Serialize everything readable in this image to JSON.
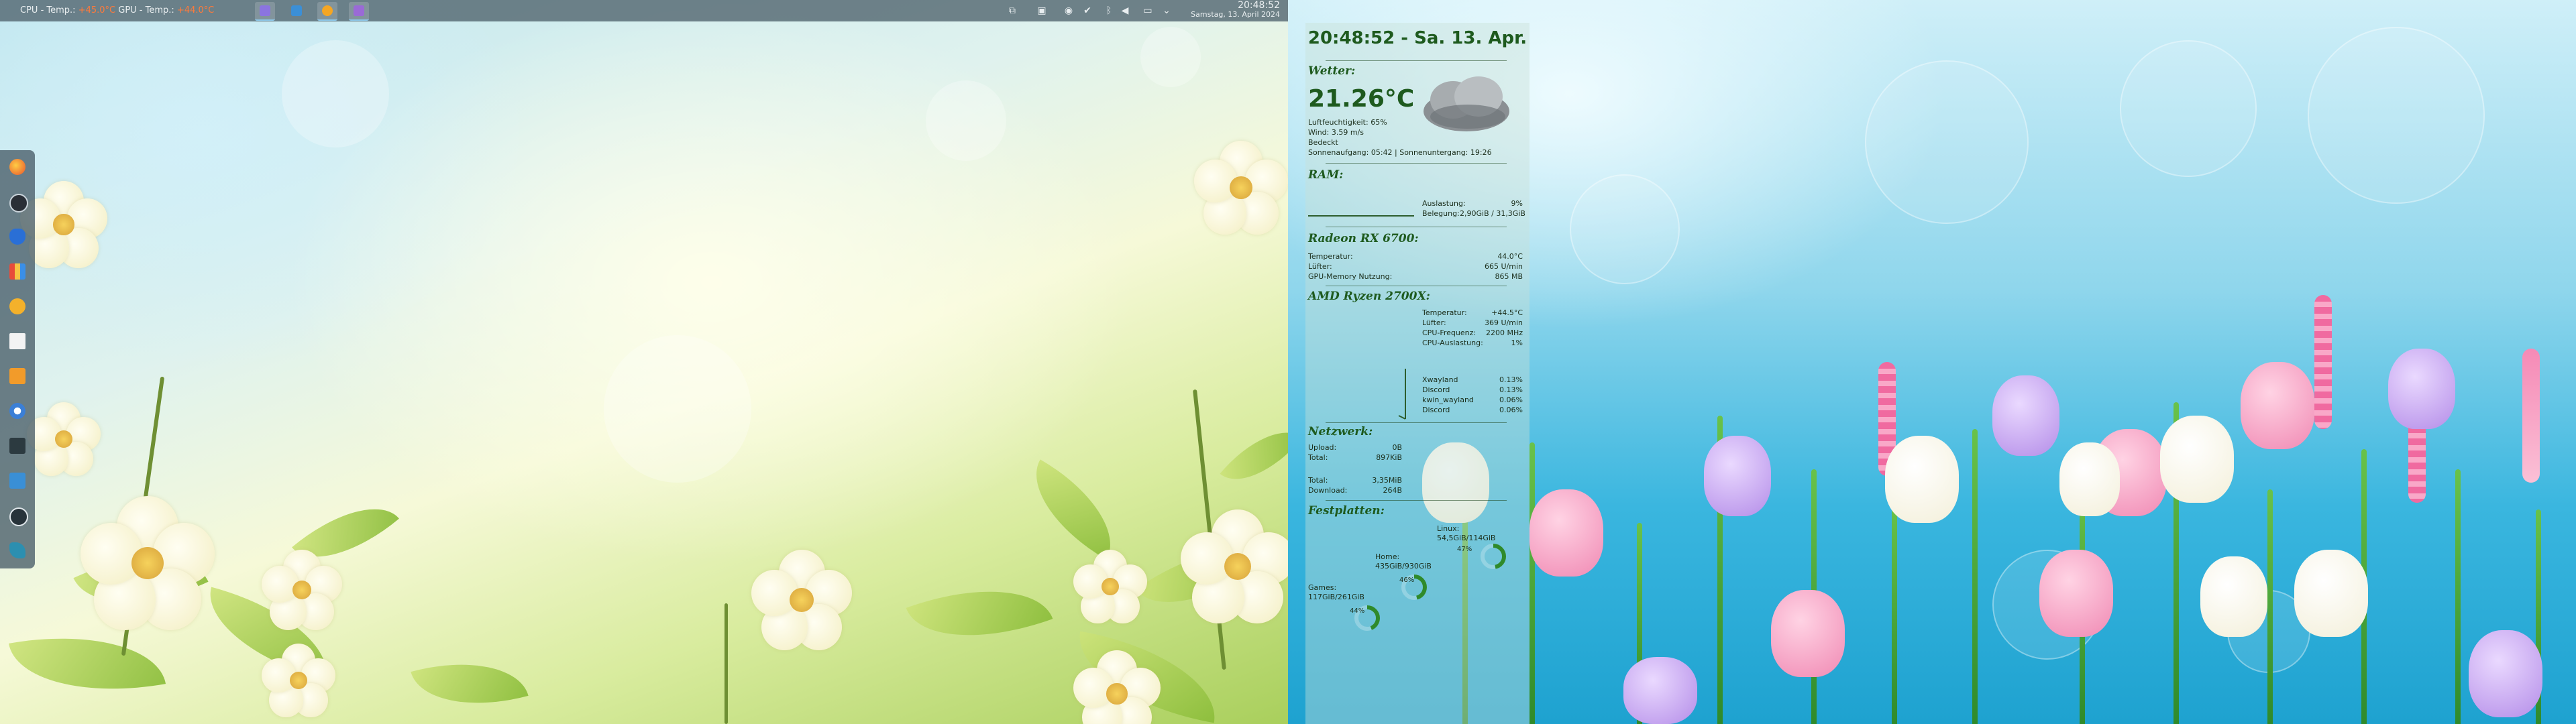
{
  "top_panel": {
    "cpu_label": "CPU - Temp.:",
    "cpu_value": "+45.0°C",
    "gpu_label": "GPU - Temp.:",
    "gpu_value": "+44.0°C",
    "clock_time": "20:48:52",
    "clock_date": "Samstag, 13. April 2024",
    "taskbar_apps": [
      "discord",
      "files",
      "firefox",
      "tasks"
    ],
    "tray_icons": [
      "bluetooth-manager-icon",
      "clipboard-icon",
      "controller-icon",
      "updates-icon",
      "bluetooth-icon",
      "volume-icon",
      "display-icon",
      "chevron-down-icon"
    ]
  },
  "dock": {
    "apps": [
      "firefox",
      "steam",
      "protonvpn",
      "app-store",
      "vlc-like",
      "text-editor",
      "media-player",
      "network",
      "terminal",
      "folder",
      "blender",
      "lutris"
    ]
  },
  "conky": {
    "clock": "20:48:52 - Sa. 13. Apr.",
    "weather": {
      "title": "Wetter:",
      "temp": "21.26°C",
      "humidity": "Luftfeuchtigkeit: 65%",
      "wind": "Wind: 3.59 m/s",
      "condition": "Bedeckt",
      "sun": "Sonnenaufgang: 05:42 | Sonnenuntergang: 19:26"
    },
    "ram": {
      "title": "RAM:",
      "usage_label": "Auslastung:",
      "usage_value": "9%",
      "used_label": "Belegung:",
      "used_value": "2,90GiB / 31,3GiB"
    },
    "gpu": {
      "title": "Radeon RX 6700:",
      "rows": [
        {
          "label": "Temperatur:",
          "value": "44.0°C"
        },
        {
          "label": "Lüfter:",
          "value": "665 U/min"
        },
        {
          "label": "GPU-Memory Nutzung:",
          "value": "865 MB"
        }
      ]
    },
    "cpu": {
      "title": "AMD Ryzen 2700X:",
      "rows": [
        {
          "label": "Temperatur:",
          "value": "+44.5°C"
        },
        {
          "label": "Lüfter:",
          "value": "369 U/min"
        },
        {
          "label": "CPU-Frequenz:",
          "value": "2200 MHz"
        },
        {
          "label": "CPU-Auslastung:",
          "value": "1%"
        }
      ],
      "processes": [
        {
          "name": "Xwayland",
          "value": "0.13%"
        },
        {
          "name": "Discord",
          "value": "0.13%"
        },
        {
          "name": "kwin_wayland",
          "value": "0.06%"
        },
        {
          "name": "Discord",
          "value": "0.06%"
        }
      ]
    },
    "network": {
      "title": "Netzwerk:",
      "upload_label": "Upload:",
      "upload_value": "0B",
      "total_label": "Total:",
      "total_value": "897KiB",
      "total2_label": "Total:",
      "total2_value": "3,35MiB",
      "download_label": "Download:",
      "download_value": "264B"
    },
    "disks": {
      "title": "Festplatten:",
      "items": [
        {
          "label": "Linux:",
          "value": "54,5GiB/114GiB",
          "pct": "47%",
          "fill": 0.47
        },
        {
          "label": "Home:",
          "value": "435GiB/930GiB",
          "pct": "46%",
          "fill": 0.46
        },
        {
          "label": "Games:",
          "value": "117GiB/261GiB",
          "pct": "44%",
          "fill": 0.44
        }
      ]
    }
  },
  "colors": {
    "panel": "#546872",
    "accent_green": "#1e5a1e",
    "hot_temp": "#ff7a3a"
  }
}
